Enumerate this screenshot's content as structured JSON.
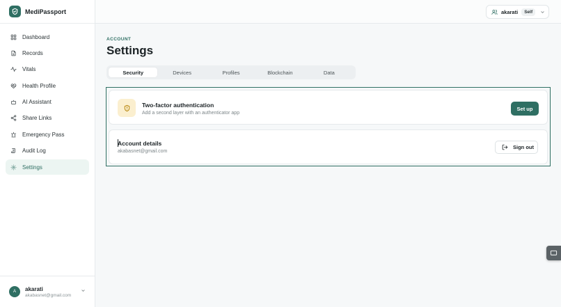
{
  "app": {
    "name": "MediPassport"
  },
  "sidebar": {
    "items": [
      {
        "label": "Dashboard",
        "icon": "grid-icon"
      },
      {
        "label": "Records",
        "icon": "file-icon"
      },
      {
        "label": "Vitals",
        "icon": "activity-icon"
      },
      {
        "label": "Health Profile",
        "icon": "heart-icon"
      },
      {
        "label": "AI Assistant",
        "icon": "bot-icon"
      },
      {
        "label": "Share Links",
        "icon": "share-icon"
      },
      {
        "label": "Emergency Pass",
        "icon": "siren-icon"
      },
      {
        "label": "Audit Log",
        "icon": "scroll-icon"
      },
      {
        "label": "Settings",
        "icon": "gear-icon",
        "active": true
      }
    ],
    "user": {
      "initial": "A",
      "name": "akarati",
      "email": "akabasnet@gmail.com"
    }
  },
  "topbar": {
    "profile_name": "akarati",
    "profile_badge": "Self"
  },
  "main": {
    "eyebrow": "ACCOUNT",
    "title": "Settings",
    "tabs": [
      "Security",
      "Devices",
      "Profiles",
      "Blockchain",
      "Data"
    ],
    "active_tab": "Security",
    "two_factor": {
      "title": "Two-factor authentication",
      "subtitle": "Add a second layer with an authenticator app",
      "button": "Set up"
    },
    "account": {
      "title": "Account details",
      "email": "akabasnet@gmail.com",
      "button": "Sign out"
    }
  },
  "colors": {
    "accent": "#2f6f63",
    "active_bg": "#ecf5f2",
    "warning_bg": "#fbefcf",
    "warning_icon": "#b8870f"
  }
}
